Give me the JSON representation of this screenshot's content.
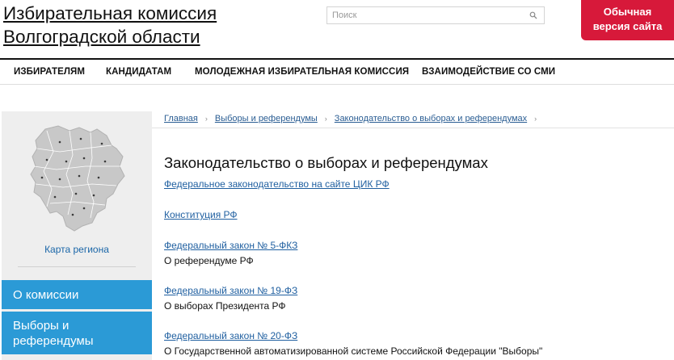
{
  "header": {
    "title_line1": "Избирательная комиссия",
    "title_line2": "Волгоградской области",
    "search_placeholder": "Поиск",
    "version_line1": "Обычная",
    "version_line2": "версия сайта",
    "accent_color": "#d7193a"
  },
  "nav": [
    {
      "label": "ИЗБИРАТЕЛЯМ"
    },
    {
      "label": "КАНДИДАТАМ"
    },
    {
      "label": "МОЛОДЕЖНАЯ ИЗБИРАТЕЛЬНАЯ КОМИССИЯ"
    },
    {
      "label": "ВЗАИМОДЕЙСТВИЕ СО СМИ"
    }
  ],
  "sidebar": {
    "map_label": "Карта региона",
    "items": [
      {
        "label": "О комиссии"
      },
      {
        "label": "Выборы и референдумы"
      }
    ],
    "item_color": "#2b9ad6"
  },
  "breadcrumbs": [
    {
      "label": "Главная"
    },
    {
      "label": "Выборы и референдумы"
    },
    {
      "label": "Законодательство о выборах и референдумах"
    }
  ],
  "main": {
    "title": "Законодательство о выборах и референдумах",
    "links": [
      {
        "label": "Федеральное законодательство на сайте ЦИК РФ",
        "desc": ""
      },
      {
        "label": "Конституция РФ",
        "desc": ""
      },
      {
        "label": "Федеральный закон № 5-ФКЗ ",
        "desc": "О референдуме РФ"
      },
      {
        "label": "Федеральный закон № 19-ФЗ ",
        "desc": "О выборах Президента РФ"
      },
      {
        "label": "Федеральный закон № 20-ФЗ ",
        "desc": "О Государственной автоматизированной системе Российской Федерации \"Выборы\""
      }
    ]
  }
}
